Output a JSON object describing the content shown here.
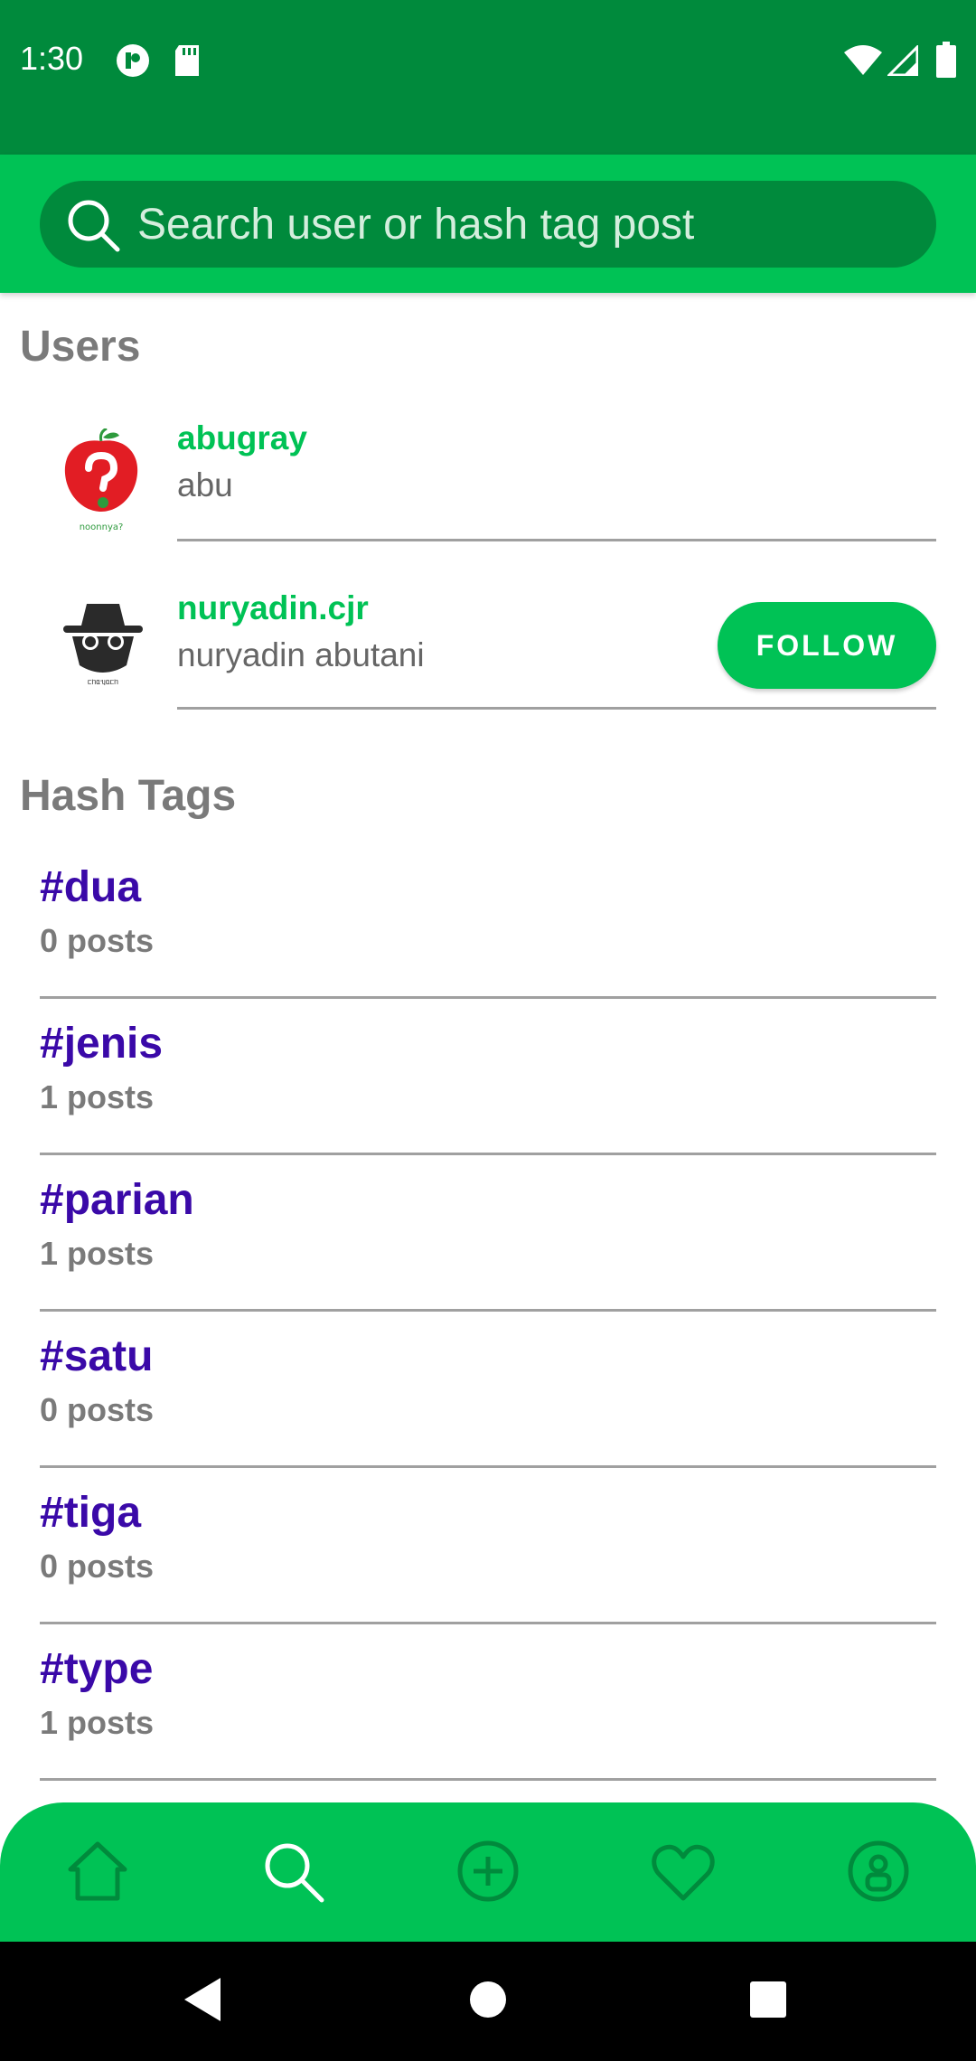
{
  "status_bar": {
    "time": "1:30",
    "icons": [
      "notification-icon",
      "sd-card-icon",
      "wifi-icon",
      "signal-icon",
      "battery-icon"
    ]
  },
  "search": {
    "placeholder": "Search user or hash tag post",
    "icon": "search-icon"
  },
  "users_section": {
    "title": "Users",
    "items": [
      {
        "username": "abugray",
        "full_name": "abu",
        "avatar": "red-apple-logo",
        "follow": false
      },
      {
        "username": "nuryadin.cjr",
        "full_name": "nuryadin abutani",
        "avatar": "spy-hat-logo",
        "follow": true,
        "follow_label": "FOLLOW"
      }
    ]
  },
  "hashtags_section": {
    "title": "Hash Tags",
    "items": [
      {
        "tag": "#dua",
        "count": "0 posts"
      },
      {
        "tag": "#jenis",
        "count": "1 posts"
      },
      {
        "tag": "#parian",
        "count": "1 posts"
      },
      {
        "tag": "#satu",
        "count": "0 posts"
      },
      {
        "tag": "#tiga",
        "count": "0 posts"
      },
      {
        "tag": "#type",
        "count": "1 posts"
      }
    ]
  },
  "bottom_nav": {
    "items": [
      "home-icon",
      "search-icon",
      "add-icon",
      "heart-icon",
      "profile-icon"
    ],
    "active": "search-icon"
  },
  "colors": {
    "status_bar": "#008a3c",
    "primary": "#00c255",
    "search_box": "#008a3c",
    "hashtag": "#3a09a8",
    "muted_text": "#7a7a7a"
  }
}
